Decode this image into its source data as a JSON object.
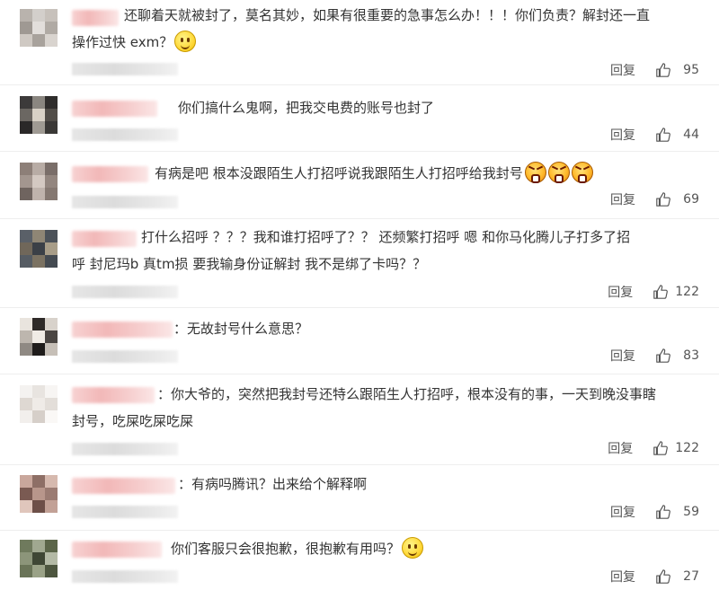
{
  "reply_label": "回复",
  "colors": {
    "name_blur": "#f2b8b8",
    "text": "#333333",
    "meta": "#555555"
  },
  "comments": [
    {
      "lines": [
        "还聊着天就被封了，莫名其妙，如果有很重要的急事怎么办！！！你们负责？解封还一直",
        "操作过快 exm？"
      ],
      "emoji": "smile",
      "likes": "95"
    },
    {
      "lines": [
        "你们搞什么鬼啊，把我交电费的账号也封了"
      ],
      "likes": "44"
    },
    {
      "lines": [
        "有病是吧  根本没跟陌生人打招呼说我跟陌生人打招呼给我封号"
      ],
      "emoji": "angry-x3",
      "likes": "69"
    },
    {
      "lines": [
        "打什么招呼 ？？？我和谁打招呼了？？  还频繁打招呼    嗯  和你马化腾儿子打多了招",
        "呼  封尼玛b 真tm损  要我输身份证解封  我不是绑了卡吗？？"
      ],
      "likes": "122"
    },
    {
      "lines": [
        "：无故封号什么意思？"
      ],
      "likes": "83"
    },
    {
      "lines": [
        "：你大爷的，突然把我封号还特么跟陌生人打招呼，根本没有的事，一天到晚没事瞎",
        "封号，吃屎吃屎吃屎"
      ],
      "likes": "122"
    },
    {
      "lines": [
        "：有病吗腾讯？出来给个解释啊"
      ],
      "likes": "59"
    },
    {
      "lines": [
        "你们客服只会很抱歉，很抱歉有用吗？"
      ],
      "emoji": "smile",
      "likes": "27"
    }
  ]
}
